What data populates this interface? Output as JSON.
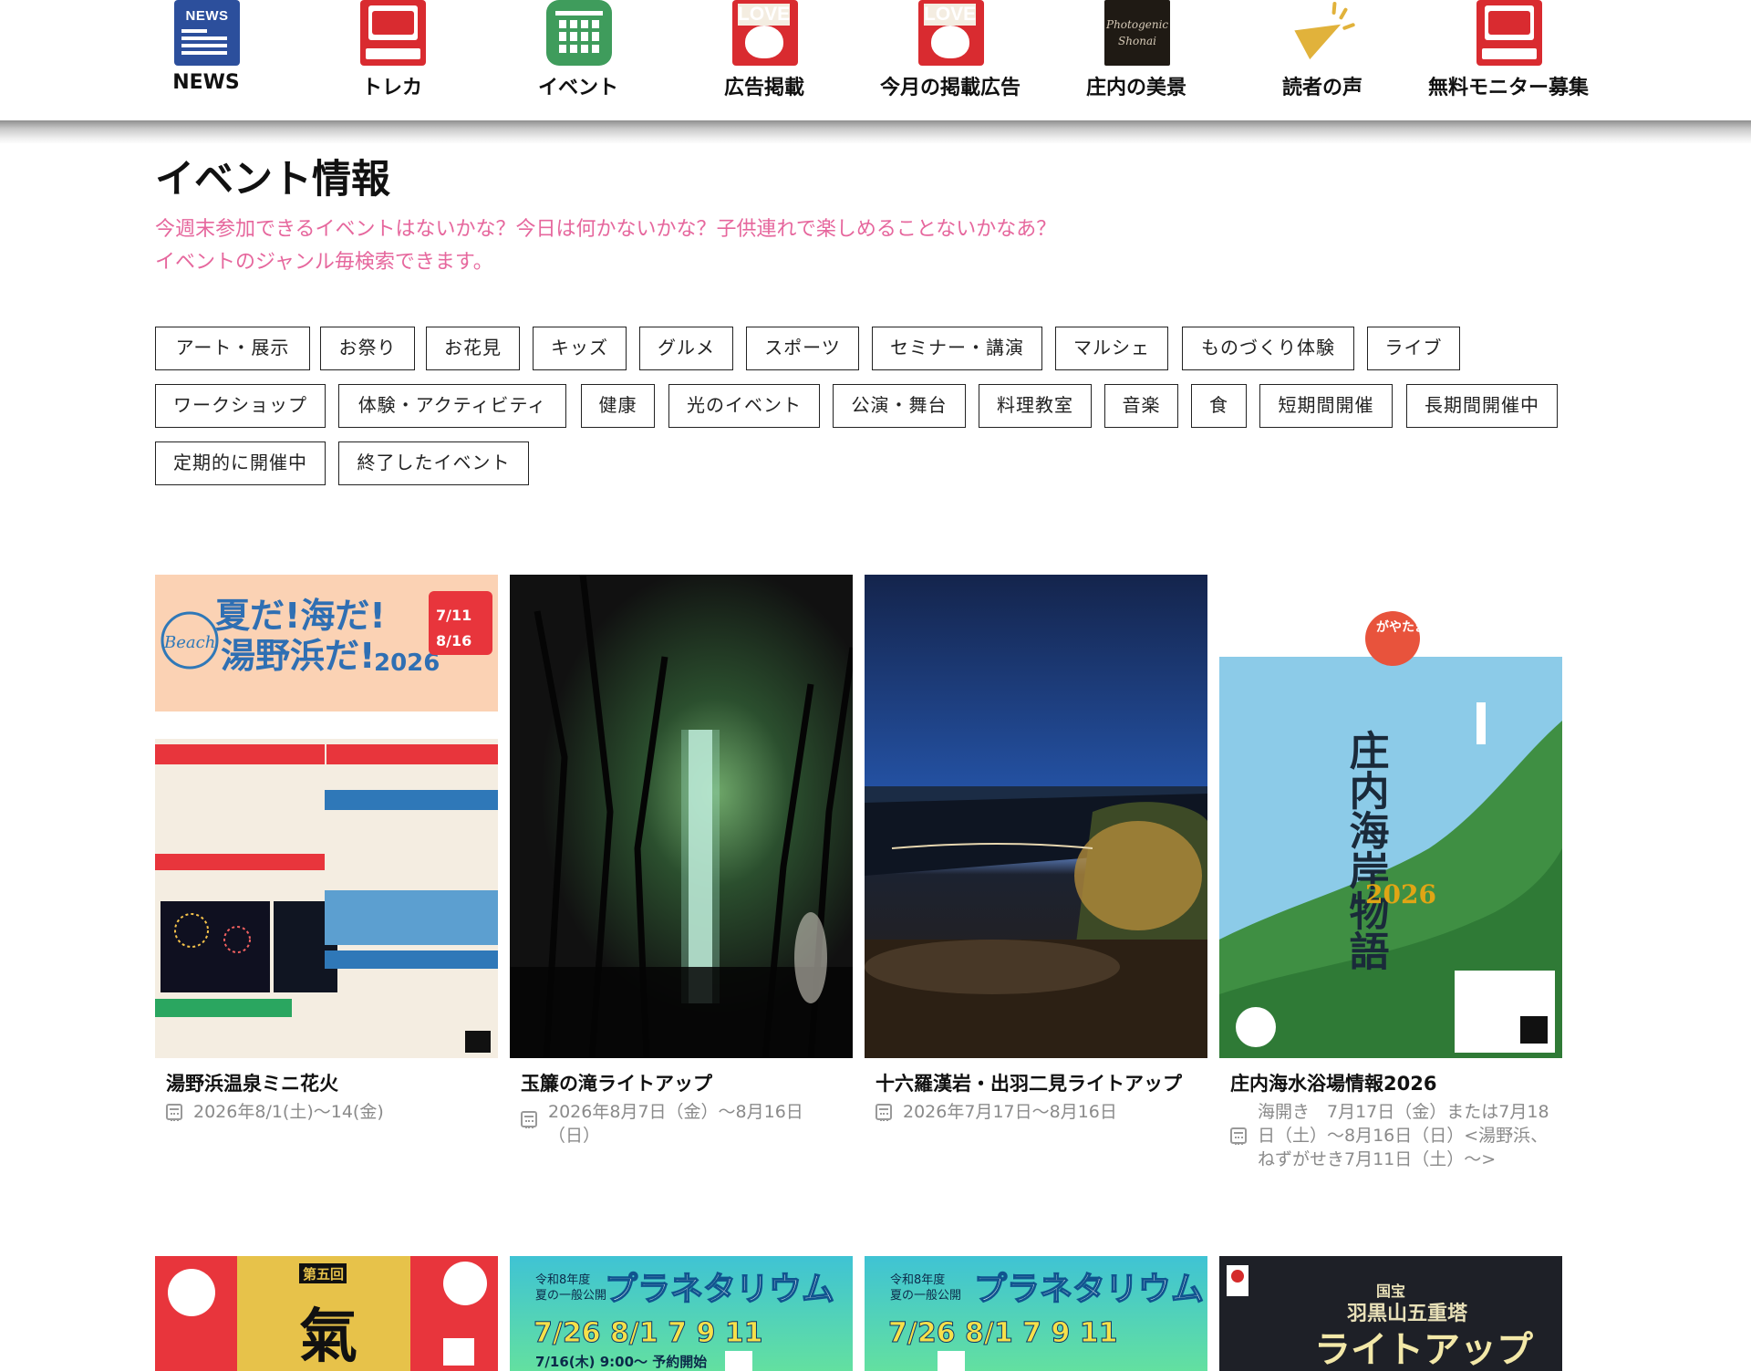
{
  "nav": {
    "items": [
      {
        "label": "NEWS",
        "icon": "news-icon"
      },
      {
        "label": "トレカ",
        "icon": "trading-card-icon"
      },
      {
        "label": "イベント",
        "icon": "calendar-icon"
      },
      {
        "label": "広告掲載",
        "icon": "love-shonai-icon"
      },
      {
        "label": "今月の掲載広告",
        "icon": "love-shonai-icon"
      },
      {
        "label": "庄内の美景",
        "icon": "photogenic-shonai-icon"
      },
      {
        "label": "読者の声",
        "icon": "megaphone-icon"
      },
      {
        "label": "無料モニター募集",
        "icon": "monitor-card-icon"
      }
    ],
    "icon_texts": {
      "news": "NEWS",
      "love": "LOVE",
      "photogenic_1": "Photogenic",
      "photogenic_2": "Shonai"
    }
  },
  "page": {
    "title": "イベント情報",
    "intro_line1": "今週末参加できるイベントはないかな？今日は何かないかな？子供連れで楽しめることないかなあ？",
    "intro_line2": "イベントのジャンル毎検索できます。"
  },
  "tags": [
    "アート・展示",
    "お祭り",
    "お花見",
    "キッズ",
    "グルメ",
    "スポーツ",
    "セミナー・講演",
    "マルシェ",
    "ものづくり体験",
    "ライブ",
    "ワークショップ",
    "体験・アクティビティ",
    "健康",
    "光のイベント",
    "公演・舞台",
    "料理教室",
    "音楽",
    "食",
    "短期間開催",
    "長期間開催中",
    "定期的に開催中",
    "終了したイベント"
  ],
  "events": [
    {
      "title": "湯野浜温泉ミニ花火",
      "date": "2026年8/1(土)〜14(金)"
    },
    {
      "title": "玉簾の滝ライトアップ",
      "date": "2026年8月7日（金）〜8月16日（日）"
    },
    {
      "title": "十六羅漢岩・出羽二見ライトアップ",
      "date": "2026年7月17日〜8月16日"
    },
    {
      "title": "庄内海水浴場情報2026",
      "date": "海開き　7月17日（金）または7月18日（土）〜8月16日（日）<湯野浜、ねずがせき7月11日（土）〜>"
    }
  ],
  "thumb_texts": {
    "yunohama_headline_1": "夏だ!海だ!",
    "yunohama_headline_2": "湯野浜だ!",
    "yunohama_year": "2026",
    "yunohama_beach": "Beach",
    "yunohama_period": "7/11",
    "yunohama_period_end": "8/16",
    "shonai_title": "庄内海岸物語",
    "shonai_year": "2026",
    "shonai_stamp": "がやたま",
    "planetarium_title": "プラネタリウム",
    "planetarium_era": "令和8年度",
    "planetarium_season": "夏の一般公開",
    "planetarium_dates": "7/26 8/1 7 9 11",
    "planetarium_reserve": "7/16(木) 9:00〜 予約開始",
    "haguro_label": "国宝",
    "haguro_name": "羽黒山五重塔",
    "haguro_title": "ライトアップ",
    "kiai_round": "第五回",
    "kiai_char": "氣"
  },
  "colors": {
    "accent_pink": "#e6679d",
    "nav_news_blue": "#2c4f9c",
    "nav_red": "#d92b30",
    "nav_green": "#3f9c5c",
    "megaphone_yellow": "#e1b23b"
  }
}
